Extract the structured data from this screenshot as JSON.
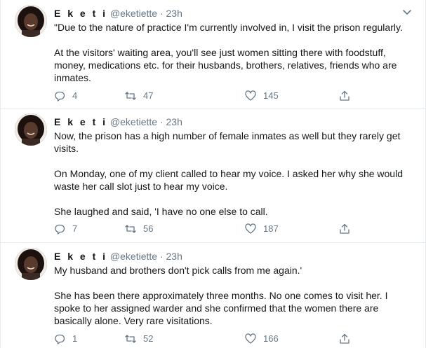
{
  "tweets": [
    {
      "name": "E k e t i",
      "handle": "@eketiette",
      "sep": "·",
      "time": "23h",
      "paragraphs": [
        "\"Due to the nature of practice I'm currently involved in, I visit the prison regularly.",
        "At the visitors' waiting area, you'll see just women sitting there with foodstuff, money, medications etc. for their husbands, brothers, relatives, friends who are inmates."
      ],
      "replies": "4",
      "retweets": "47",
      "likes": "145"
    },
    {
      "name": "E k e t i",
      "handle": "@eketiette",
      "sep": "·",
      "time": "23h",
      "paragraphs": [
        "Now, the prison has a high number of female inmates as well but they rarely get visits.",
        "On Monday, one of my client called to hear my voice. I asked her why she would waste her call slot just to hear my voice.",
        "She laughed and said, 'I have no one else to call."
      ],
      "replies": "7",
      "retweets": "56",
      "likes": "187"
    },
    {
      "name": "E k e t i",
      "handle": "@eketiette",
      "sep": "·",
      "time": "23h",
      "paragraphs": [
        "My husband and brothers don't pick calls from me again.'",
        "She has been there approximately three months. No one comes to visit her. I spoke to her assigned warder and she confirmed that the women there are basically alone. Very rare visitations."
      ],
      "replies": "1",
      "retweets": "52",
      "likes": "166"
    }
  ],
  "icons": {
    "reply": "reply-icon",
    "retweet": "retweet-icon",
    "like": "heart-icon",
    "share": "share-icon",
    "more": "chevron-down-icon"
  },
  "colors": {
    "text": "#14171a",
    "secondary": "#657786",
    "border": "#e6ecf0"
  }
}
